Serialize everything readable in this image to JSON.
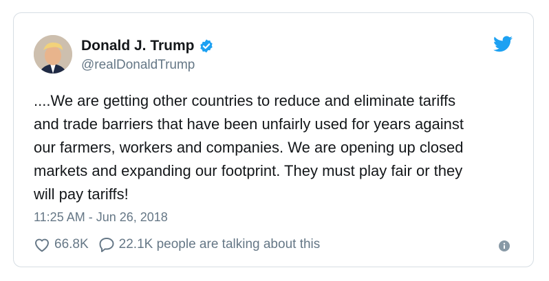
{
  "author": {
    "name": "Donald J. Trump",
    "handle": "@realDonaldTrump",
    "verified": true
  },
  "tweet": {
    "text": "....We are getting other countries to reduce and eliminate tariffs\nand trade barriers that have been unfairly used for years against\nour farmers, workers and companies. We are opening up closed\nmarkets and expanding our footprint. They must play fair or they\nwill pay tariffs!",
    "timestamp": "11:25 AM - Jun 26, 2018"
  },
  "actions": {
    "likes": "66.8K",
    "talking": "22.1K people are talking about this"
  },
  "icons": [
    "heart-icon",
    "reply-icon",
    "twitter-bird-icon",
    "verified-badge-icon",
    "info-icon"
  ],
  "colors": {
    "accent": "#1da1f2",
    "secondary_text": "#657786",
    "primary_text": "#14171a"
  }
}
